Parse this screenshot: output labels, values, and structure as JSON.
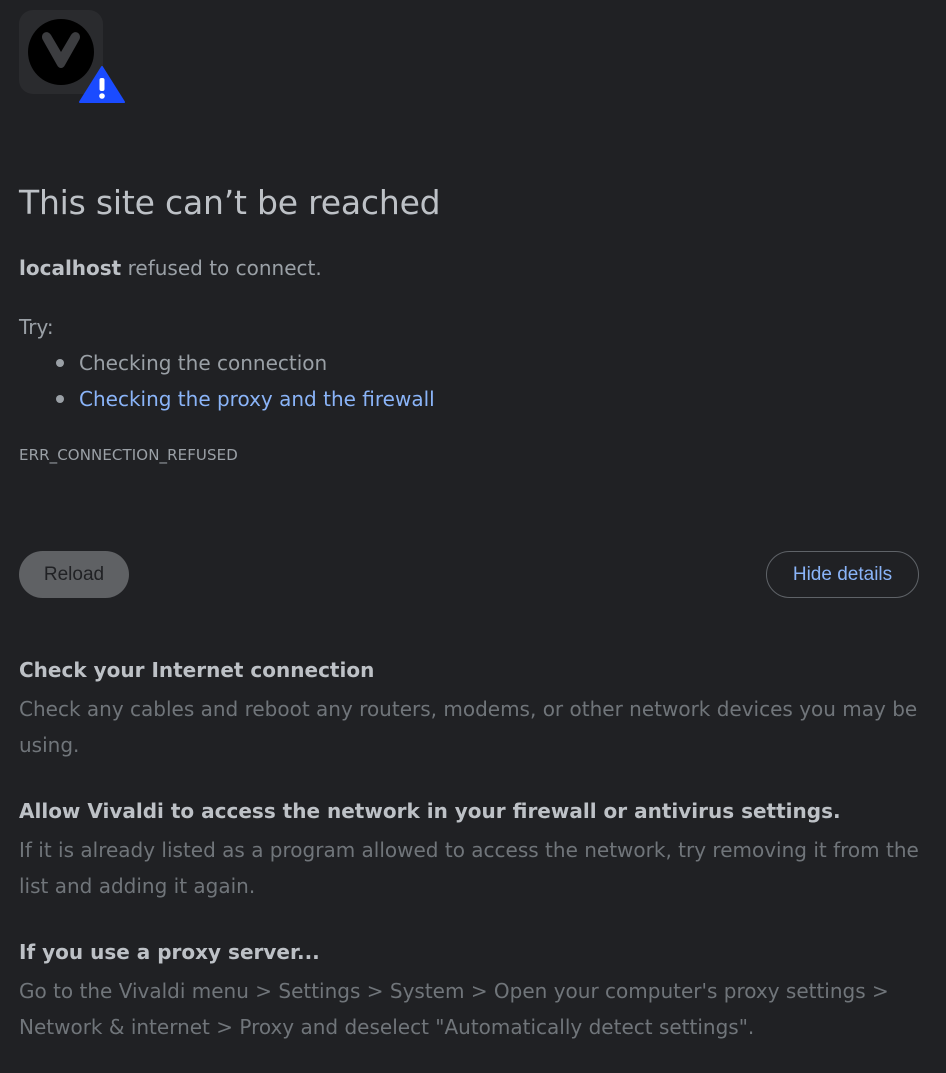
{
  "icons": {
    "logo": "vivaldi-logo-icon",
    "warning": "warning-triangle-icon"
  },
  "colors": {
    "background": "#202124",
    "heading": "#bdc1c6",
    "text": "#9aa0a6",
    "link": "#8ab4f8",
    "warning": "#1a4bff"
  },
  "error": {
    "title": "This site can’t be reached",
    "host": "localhost",
    "message": " refused to connect.",
    "try_label": "Try:",
    "suggestions": [
      {
        "text": "Checking the connection",
        "is_link": false
      },
      {
        "text": "Checking the proxy and the firewall",
        "is_link": true
      }
    ],
    "code": "ERR_CONNECTION_REFUSED"
  },
  "buttons": {
    "reload": "Reload",
    "hide_details": "Hide details"
  },
  "details": [
    {
      "heading": "Check your Internet connection",
      "body": "Check any cables and reboot any routers, modems, or other network devices you may be using."
    },
    {
      "heading": "Allow Vivaldi to access the network in your firewall or antivirus settings.",
      "body": "If it is already listed as a program allowed to access the network, try removing it from the list and adding it again."
    },
    {
      "heading": "If you use a proxy server...",
      "body": "Go to the Vivaldi menu > Settings > System > Open your computer's proxy settings > Network & internet > Proxy and deselect \"Automatically detect settings\"."
    }
  ]
}
